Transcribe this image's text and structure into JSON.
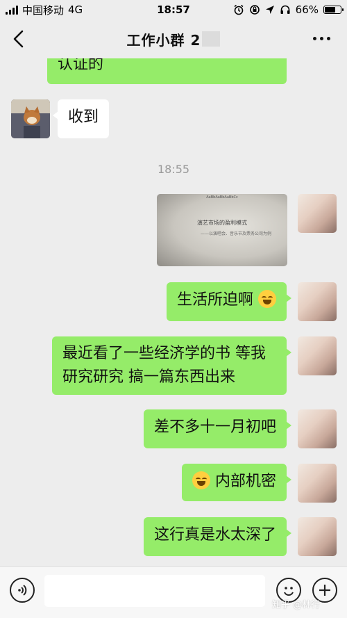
{
  "status_bar": {
    "carrier": "中国移动",
    "network": "4G",
    "time": "18:57",
    "battery": "66%",
    "battery_level": 0.66
  },
  "nav": {
    "title": "工作小群 2"
  },
  "messages": {
    "top_partial": "认证的",
    "received_1": "收到",
    "time_divider": "18:55",
    "image": {
      "toolbar_text": "AaBbAaBbAaBbCc",
      "doc_title": "演艺市场的盈利模式",
      "doc_subtitle": "——以演唱会、音乐节及票务公司为例"
    },
    "sent_1": "生活所迫啊",
    "sent_2_line1": "最近看了一些经济学的书 等我",
    "sent_2_line2": "研究研究 搞一篇东西出来",
    "sent_3": "差不多十一月初吧",
    "sent_4": "内部机密",
    "sent_5": "这行真是水太深了"
  },
  "input_bar": {
    "watermark": "知乎 @林行"
  },
  "colors": {
    "background": "#ededed",
    "sent_bubble": "#95ec69",
    "received_bubble": "#ffffff",
    "timestamp": "#9a9a9a"
  }
}
